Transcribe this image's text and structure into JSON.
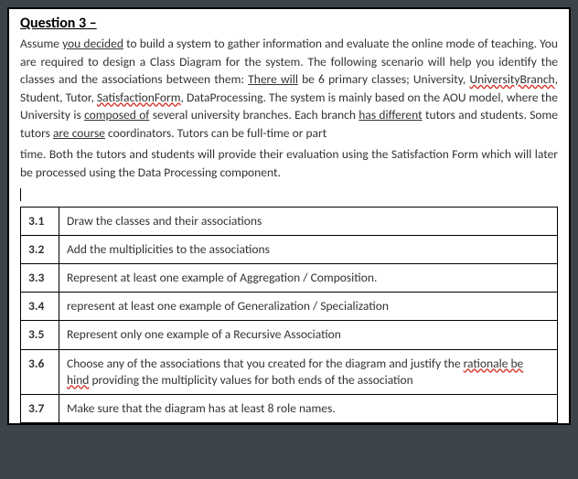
{
  "title": "Question 3 –",
  "paragraphs": {
    "p1_a": "Assume ",
    "p1_b": "you decided",
    "p1_c": " to build a system to gather information and evaluate the online mode of teaching. You are required to design a Class Diagram for the system. The following scenario will help you identify the classes and the associations between them: ",
    "p1_d": "There will",
    "p1_e": " be 6 primary classes; University, ",
    "p1_f": "UniversityBranch",
    "p1_g": ", Student, Tutor, ",
    "p1_h": "SatisfactionForm",
    "p1_i": ", DataProcessing. The system is mainly based on the AOU model, where the University is ",
    "p1_j": "composed of",
    "p1_k": " several university branches. Each branch ",
    "p1_l": "has different",
    "p1_m": " tutors and students. Some tutors ",
    "p1_n": "are course",
    "p1_o": " coordinators. Tutors can be full-time or part",
    "p2": "time. Both the tutors and students will provide their evaluation using the Satisfaction Form which will later be processed using the Data Processing component."
  },
  "tasks": [
    {
      "num": "3.1",
      "text": "Draw the classes and their associations"
    },
    {
      "num": "3.2",
      "text": "Add the multiplicities to the associations"
    },
    {
      "num": "3.3",
      "text": "Represent at least one example of Aggregation / Composition."
    },
    {
      "num": "3.4",
      "text": "represent at least one example of Generalization / Specialization"
    },
    {
      "num": "3.5",
      "text": "Represent only one example of a Recursive Association"
    },
    {
      "num": "3.6",
      "text_a": "Choose any of the associations that you created for the diagram and justify the ",
      "spell_a": "rationale be",
      "spell_b": "hind",
      "text_b": " providing the multiplicity values for both ends of the association"
    },
    {
      "num": "3.7",
      "text": "Make sure that the diagram has at least 8 role names."
    }
  ]
}
